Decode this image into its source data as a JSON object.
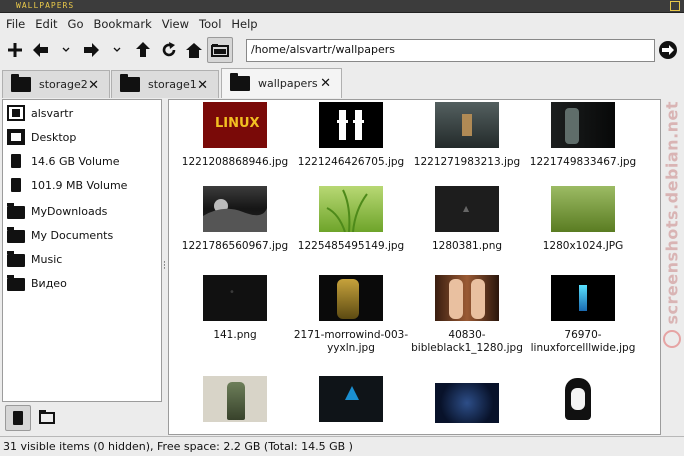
{
  "window": {
    "title": "WALLPAPERS"
  },
  "menu": [
    "File",
    "Edit",
    "Go",
    "Bookmark",
    "View",
    "Tool",
    "Help"
  ],
  "toolbar": {
    "address": "/home/alsvartr/wallpapers",
    "icons": [
      "new-icon",
      "back-icon",
      "back-history-icon",
      "forward-icon",
      "forward-history-icon",
      "up-icon",
      "reload-icon",
      "home-icon",
      "folder-view-icon",
      "go-icon"
    ]
  },
  "tabs": [
    {
      "label": "storage2",
      "active": false
    },
    {
      "label": "storage1",
      "active": false
    },
    {
      "label": "wallpapers",
      "active": true
    }
  ],
  "sidebar": {
    "items": [
      {
        "label": "alsvartr",
        "icon": "home-icon"
      },
      {
        "label": "Desktop",
        "icon": "desktop-icon"
      },
      {
        "label": "14.6 GB Volume",
        "icon": "drive-icon"
      },
      {
        "label": "101.9 MB Volume",
        "icon": "drive-icon"
      },
      {
        "label": "MyDownloads",
        "icon": "folder-icon"
      },
      {
        "label": "My Documents",
        "icon": "folder-icon"
      },
      {
        "label": "Music",
        "icon": "folder-icon"
      },
      {
        "label": "Видео",
        "icon": "folder-icon"
      }
    ]
  },
  "files": [
    {
      "name": "1221208868946.jpg",
      "thumb": "t-linux",
      "overlay": "LINUX"
    },
    {
      "name": "1221246426705.jpg",
      "thumb": "t-pulp"
    },
    {
      "name": "1221271983213.jpg",
      "thumb": "t-rain"
    },
    {
      "name": "1221749833467.jpg",
      "thumb": "t-robot"
    },
    {
      "name": "1221786560967.jpg",
      "thumb": "t-cloud"
    },
    {
      "name": "1225485495149.jpg",
      "thumb": "t-grass"
    },
    {
      "name": "1280381.png",
      "thumb": "t-dark"
    },
    {
      "name": "1280x1024.JPG",
      "thumb": "t-field"
    },
    {
      "name": "141.png",
      "thumb": "t-black"
    },
    {
      "name": "2171-morrowind-003-yyxln.jpg",
      "thumb": "t-morrow"
    },
    {
      "name": "40830-bibleblack1_1280.jpg",
      "thumb": "t-anime"
    },
    {
      "name": "76970-linuxforcelllwide.jpg",
      "thumb": "t-linuxforce"
    },
    {
      "name": "",
      "thumb": "t-bottle"
    },
    {
      "name": "",
      "thumb": "t-arch"
    },
    {
      "name": "",
      "thumb": "t-debblue"
    },
    {
      "name": "",
      "thumb": "t-face"
    }
  ],
  "status": "31 visible items (0 hidden), Free space: 2.2 GB (Total: 14.5 GB )",
  "watermark": "screenshots.debian.net"
}
